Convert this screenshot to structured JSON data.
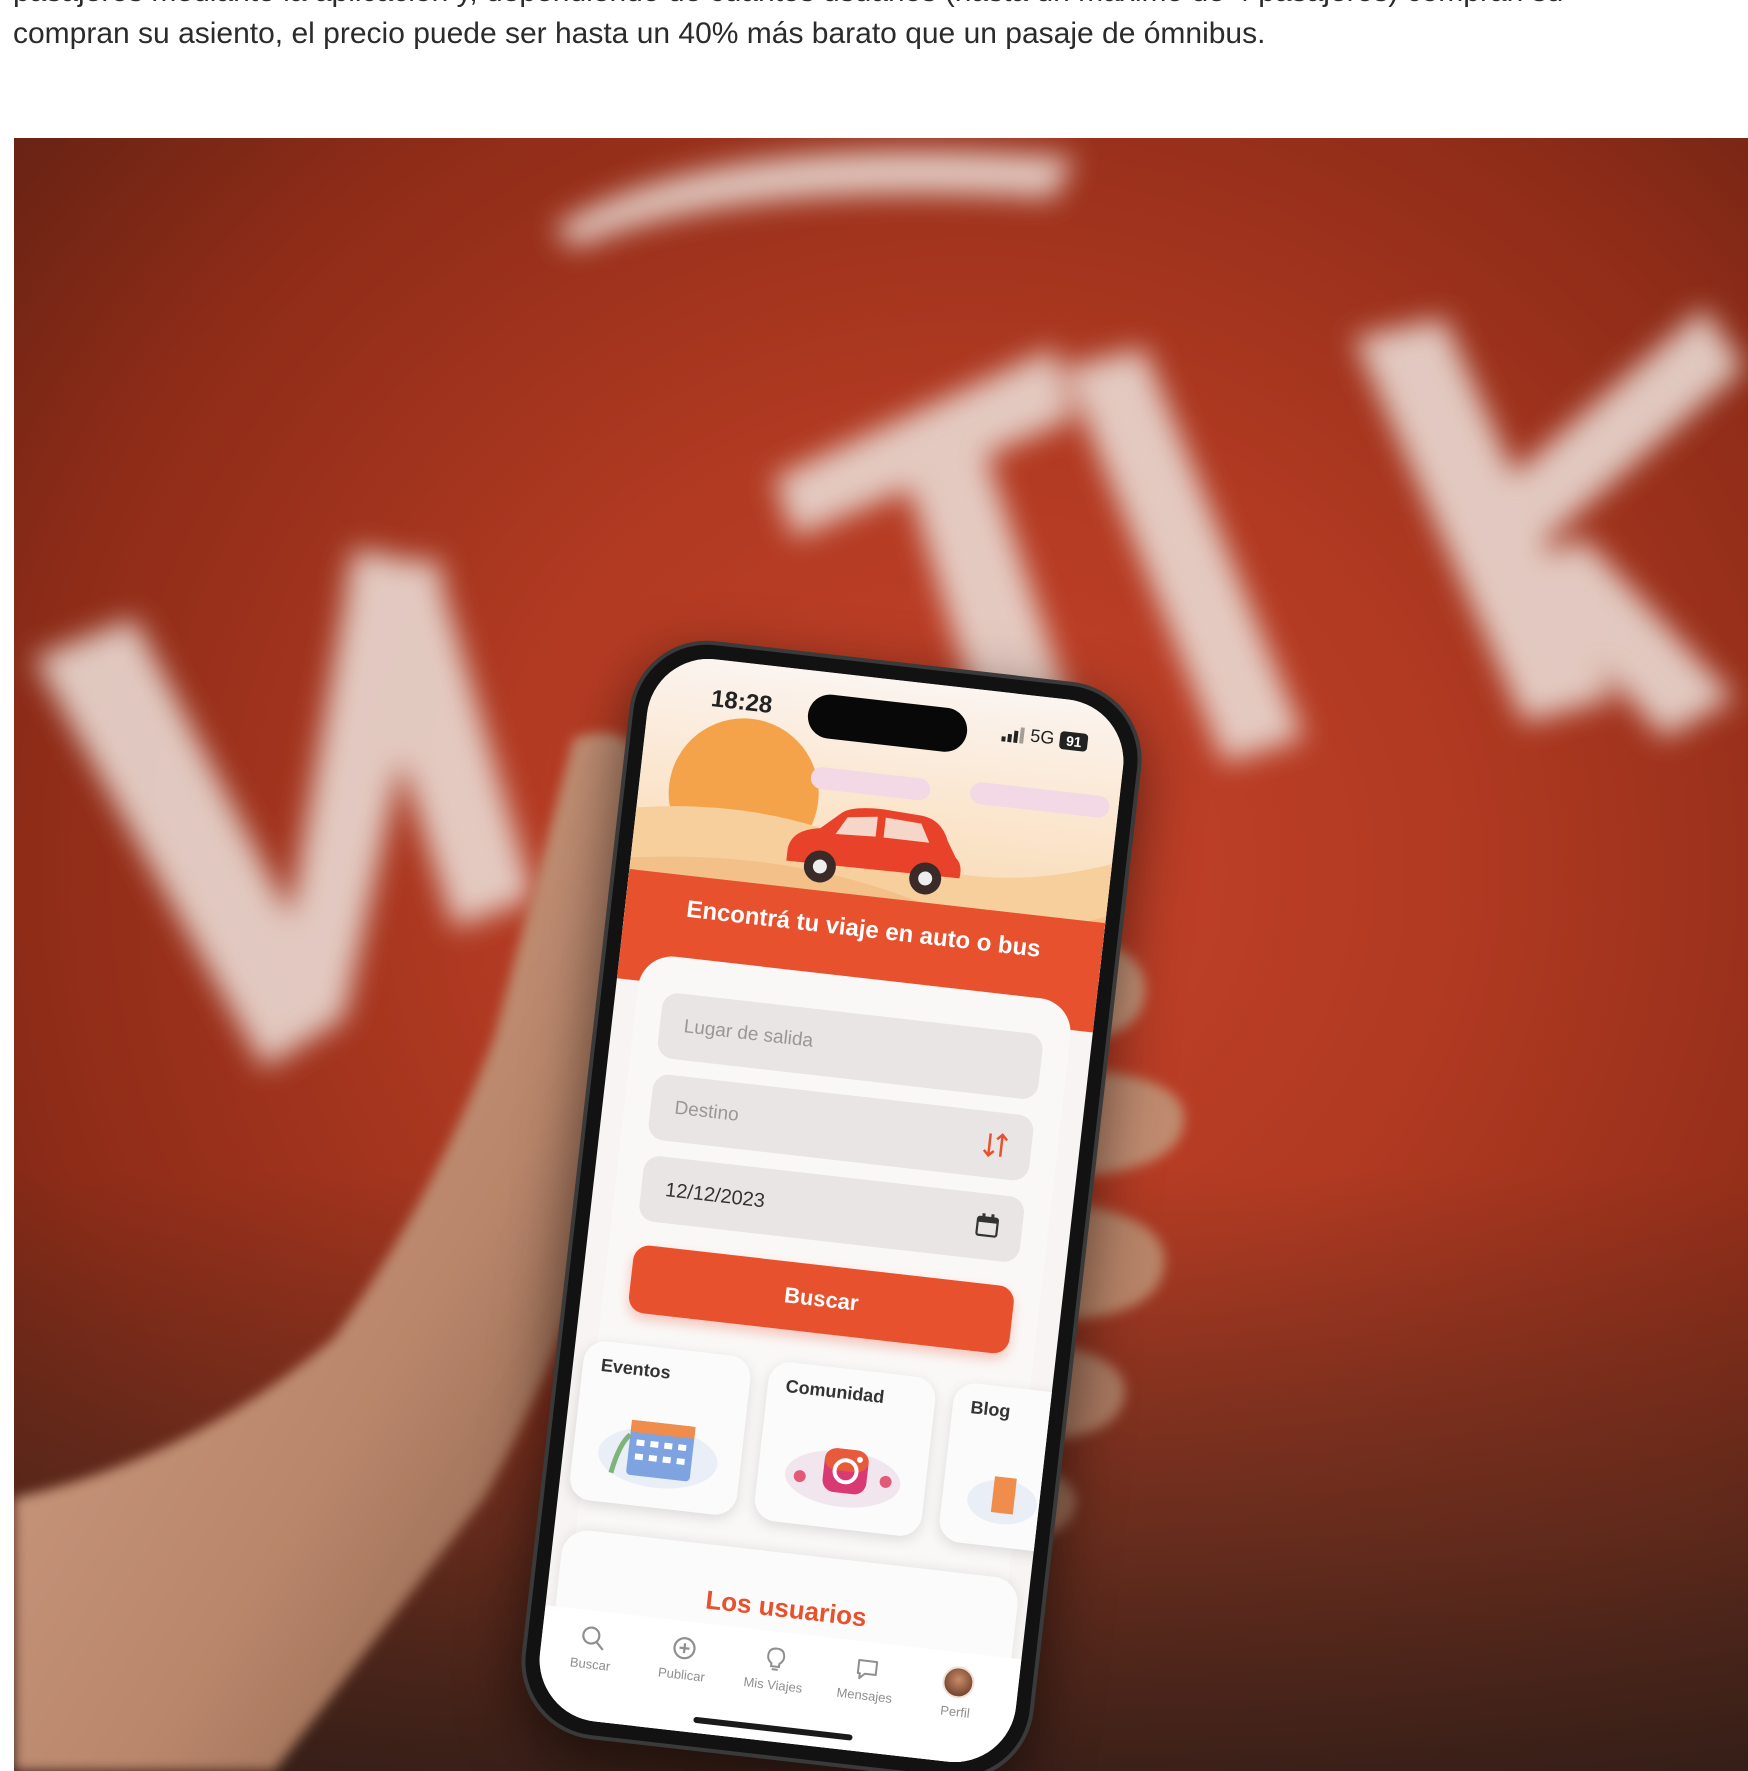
{
  "article": {
    "cut_line": "pasajeros mediante la aplicación y, dependiendo de cuántos usuarios (hasta un máximo de 4 pasajeros) compran su",
    "line2": "compran su asiento, el precio puede ser hasta un 40% más barato que un pasaje de ómnibus."
  },
  "photo": {
    "background_logo_text": "VIVITIK",
    "colors": {
      "brand_red": "#c5422a",
      "accent": "#e8512e"
    }
  },
  "app": {
    "status_bar": {
      "time": "18:28",
      "network": "5G",
      "battery": "91"
    },
    "hero_title": "Encontrá tu viaje en auto o bus",
    "search_form": {
      "origin_placeholder": "Lugar de salida",
      "destination_placeholder": "Destino",
      "date_value": "12/12/2023",
      "search_button": "Buscar"
    },
    "tiles": [
      {
        "label": "Eventos",
        "icon": "calendar-icon"
      },
      {
        "label": "Comunidad",
        "icon": "instagram-icon"
      },
      {
        "label": "Blog",
        "icon": "blog-icon"
      }
    ],
    "users_section_title": "Los usuarios",
    "tabbar": [
      {
        "label": "Buscar",
        "icon": "search-icon"
      },
      {
        "label": "Publicar",
        "icon": "plus-circle-icon"
      },
      {
        "label": "Mis Viajes",
        "icon": "lightbulb-icon"
      },
      {
        "label": "Mensajes",
        "icon": "chat-icon"
      },
      {
        "label": "Perfil",
        "icon": "avatar"
      }
    ]
  }
}
